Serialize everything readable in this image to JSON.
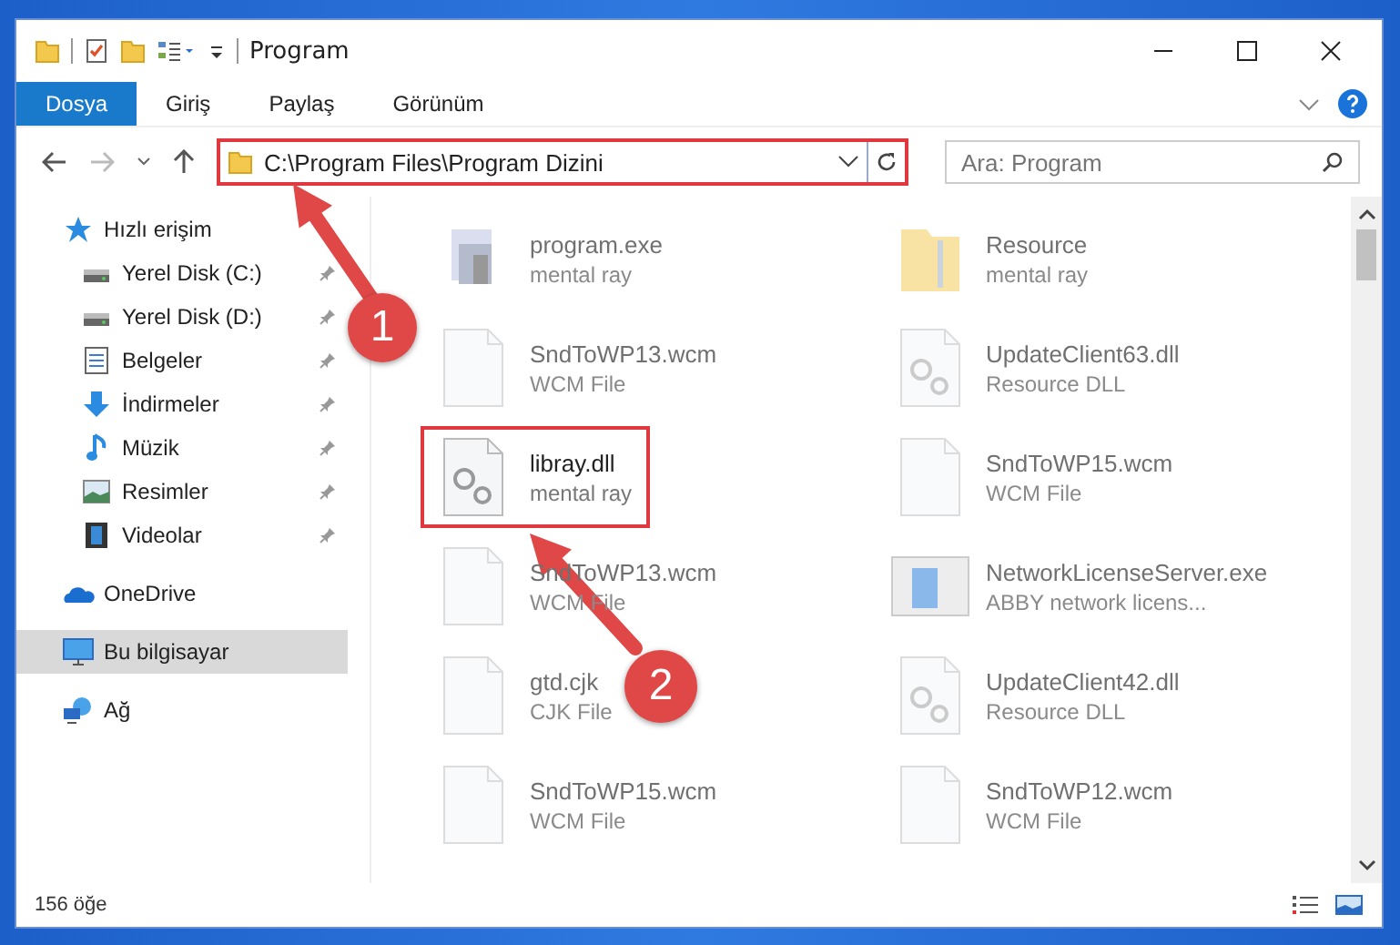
{
  "window": {
    "title": "Program"
  },
  "ribbon_tabs": [
    {
      "label": "Dosya",
      "selected": true
    },
    {
      "label": "Giriş",
      "selected": false
    },
    {
      "label": "Paylaş",
      "selected": false
    },
    {
      "label": "Görünüm",
      "selected": false
    }
  ],
  "address": {
    "value": "C:\\Program Files\\Program Dizini",
    "highlighted": true
  },
  "search": {
    "placeholder": "Ara: Program"
  },
  "sidebar": {
    "items": [
      {
        "label": "Hızlı erişim",
        "kind": "star",
        "pinned": false,
        "selected": false,
        "children": [
          {
            "label": "Yerel Disk (C:)",
            "kind": "disk",
            "pinned": true,
            "selected": false
          },
          {
            "label": "Yerel Disk (D:)",
            "kind": "disk",
            "pinned": true,
            "selected": false
          },
          {
            "label": "Belgeler",
            "kind": "docs",
            "pinned": true,
            "selected": false
          },
          {
            "label": "İndirmeler",
            "kind": "download",
            "pinned": true,
            "selected": false
          },
          {
            "label": "Müzik",
            "kind": "music",
            "pinned": true,
            "selected": false
          },
          {
            "label": "Resimler",
            "kind": "pictures",
            "pinned": true,
            "selected": false
          },
          {
            "label": "Videolar",
            "kind": "video",
            "pinned": true,
            "selected": false
          }
        ]
      },
      {
        "label": "OneDrive",
        "kind": "cloud",
        "pinned": false,
        "selected": false
      },
      {
        "label": "Bu bilgisayar",
        "kind": "pc",
        "pinned": false,
        "selected": true
      },
      {
        "label": "Ağ",
        "kind": "network",
        "pinned": false,
        "selected": false
      }
    ]
  },
  "files": [
    {
      "name": "program.exe",
      "type": "mental ray",
      "kind": "app",
      "blurred": true,
      "highlighted": false
    },
    {
      "name": "Resource",
      "type": "mental ray",
      "kind": "folder",
      "blurred": true,
      "highlighted": false
    },
    {
      "name": "SndToWP13.wcm",
      "type": "WCM File",
      "kind": "file",
      "blurred": true,
      "highlighted": false
    },
    {
      "name": "UpdateClient63.dll",
      "type": "Resource DLL",
      "kind": "dll",
      "blurred": true,
      "highlighted": false
    },
    {
      "name": "libray.dll",
      "type": "mental ray",
      "kind": "dll",
      "blurred": false,
      "highlighted": true
    },
    {
      "name": "SndToWP15.wcm",
      "type": "WCM File",
      "kind": "file",
      "blurred": true,
      "highlighted": false
    },
    {
      "name": "SndToWP13.wcm",
      "type": "WCM File",
      "kind": "file",
      "blurred": true,
      "highlighted": false
    },
    {
      "name": "NetworkLicenseServer.exe",
      "type": "ABBY network licens...",
      "kind": "window",
      "blurred": true,
      "highlighted": false
    },
    {
      "name": "gtd.cjk",
      "type": "CJK File",
      "kind": "file",
      "blurred": true,
      "highlighted": false
    },
    {
      "name": "UpdateClient42.dll",
      "type": "Resource DLL",
      "kind": "dll",
      "blurred": true,
      "highlighted": false
    },
    {
      "name": "SndToWP15.wcm",
      "type": "WCM File",
      "kind": "file",
      "blurred": true,
      "highlighted": false
    },
    {
      "name": "SndToWP12.wcm",
      "type": "WCM File",
      "kind": "file",
      "blurred": true,
      "highlighted": false
    }
  ],
  "status_bar": {
    "item_count": "156 öğe"
  },
  "annotations": [
    {
      "number": "1"
    },
    {
      "number": "2"
    }
  ]
}
